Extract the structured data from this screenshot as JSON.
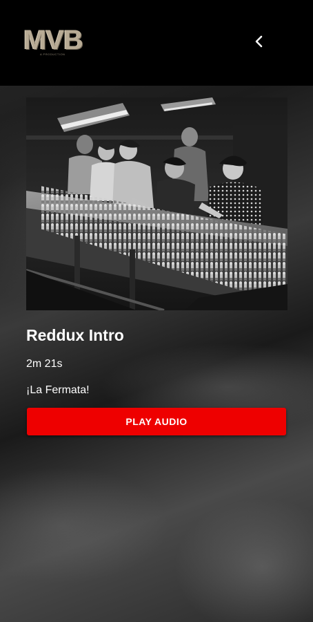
{
  "header": {
    "logo_text": "MVB",
    "logo_subtext": "A PRODUCTION",
    "back_icon": "chevron-left-icon"
  },
  "artwork": {
    "description_icon": "factory-workers-photo"
  },
  "track": {
    "title": "Reddux Intro",
    "duration": "2m 21s",
    "subtitle": "¡La Fermata!"
  },
  "actions": {
    "play_label": "PLAY AUDIO"
  },
  "colors": {
    "accent": "#ee0000",
    "header_bg": "#000000",
    "text": "#ffffff",
    "logo": "#b8ab95"
  }
}
